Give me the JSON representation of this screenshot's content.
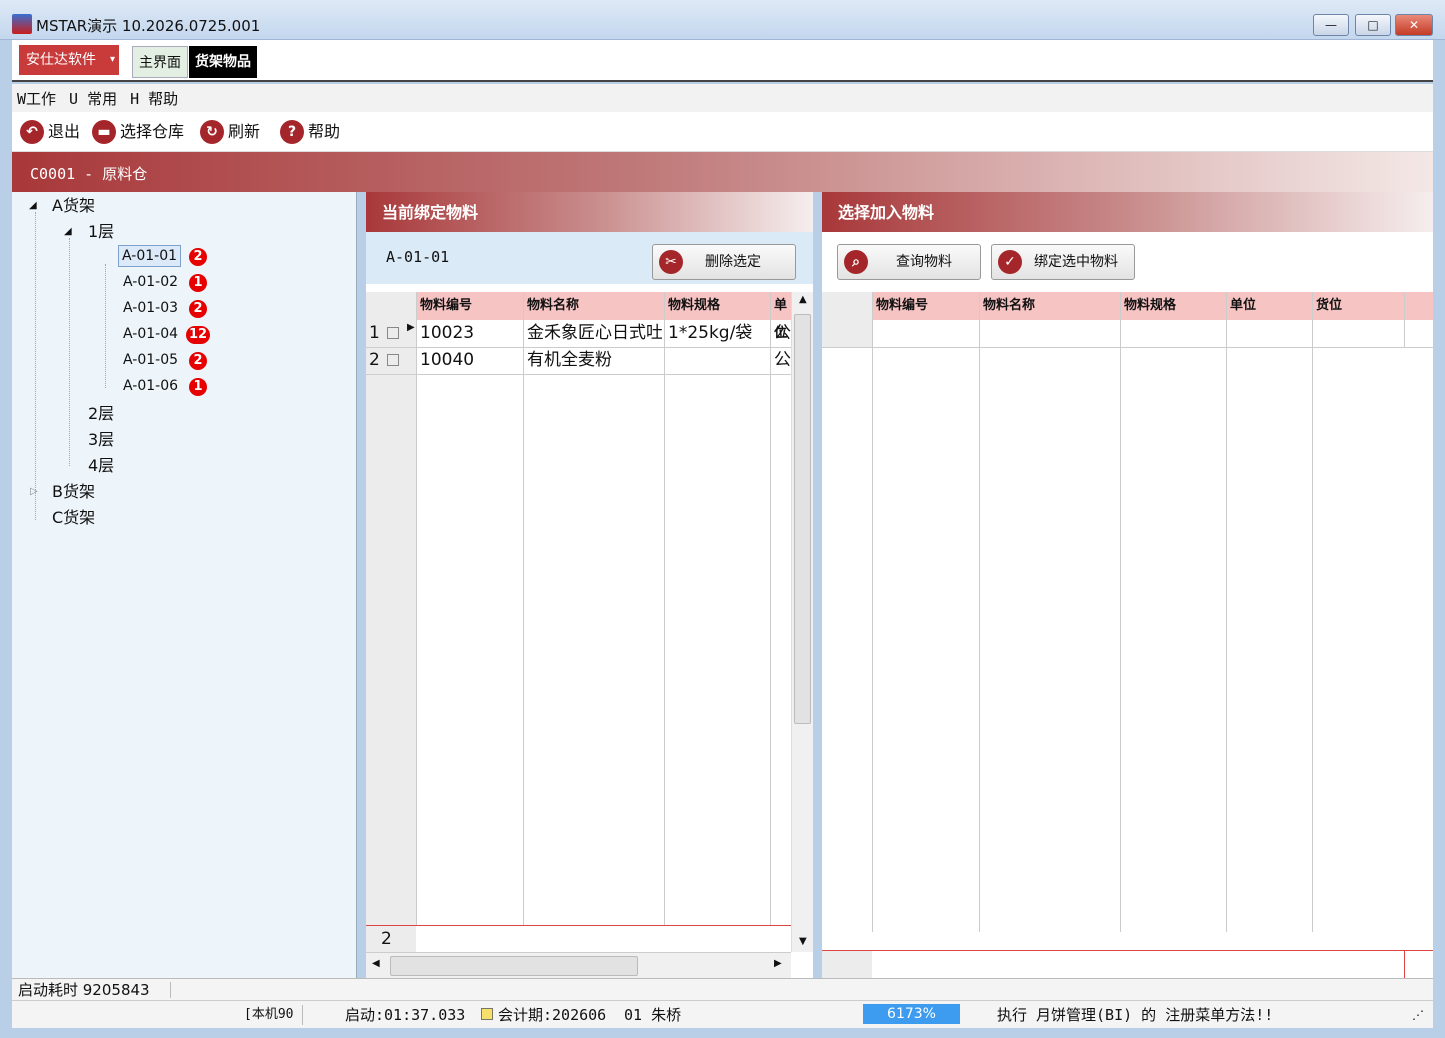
{
  "window": {
    "title": "MSTAR演示  10.2026.0725.001",
    "min": "—",
    "max": "□",
    "close": "✕"
  },
  "top": {
    "company": "安仕达软件",
    "dropdown": "▾",
    "tabs": [
      "主界面",
      "货架物品"
    ]
  },
  "menu": [
    "W工作",
    "U 常用",
    "H 帮助"
  ],
  "toolbar": {
    "exit": "退出",
    "select_warehouse": "选择仓库",
    "refresh": "刷新",
    "help": "帮助"
  },
  "warehouse": "C0001 - 原料仓",
  "tree": {
    "shelf_a": "A货架",
    "floor1": "1层",
    "positions": [
      {
        "label": "A-01-01",
        "count": "2"
      },
      {
        "label": "A-01-02",
        "count": "1"
      },
      {
        "label": "A-01-03",
        "count": "2"
      },
      {
        "label": "A-01-04",
        "count": "12"
      },
      {
        "label": "A-01-05",
        "count": "2"
      },
      {
        "label": "A-01-06",
        "count": "1"
      }
    ],
    "floor2": "2层",
    "floor3": "3层",
    "floor4": "4层",
    "shelf_b": "B货架",
    "shelf_c": "C货架"
  },
  "bound": {
    "title": "当前绑定物料",
    "position": "A-01-01",
    "delete_btn": "删除选定",
    "columns": [
      "物料编号",
      "物料名称",
      "物料规格",
      "单位"
    ],
    "rows": [
      {
        "no": "1",
        "code": "10023",
        "name": "金禾象匠心日式吐",
        "spec": "1*25kg/袋",
        "unit": "公"
      },
      {
        "no": "2",
        "code": "10040",
        "name": "有机全麦粉",
        "spec": "",
        "unit": "公"
      }
    ],
    "footer_count": "2"
  },
  "select": {
    "title": "选择加入物料",
    "query_btn": "查询物料",
    "bind_btn": "绑定选中物料",
    "columns": [
      "物料编号",
      "物料名称",
      "物料规格",
      "单位",
      "货位"
    ]
  },
  "status": {
    "startup_time": "启动耗时  9205843",
    "machine": "[本机90",
    "boot": "启动:01:37.033",
    "period": "会计期:202606",
    "user": "01 朱桥",
    "progress": "6173%",
    "message": "执行 月饼管理(BI) 的 注册菜单方法!!"
  }
}
